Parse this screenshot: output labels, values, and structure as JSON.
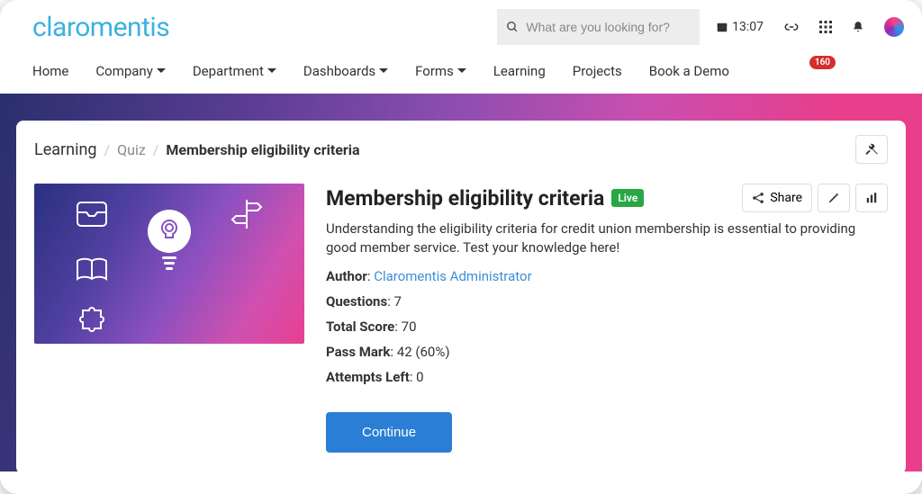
{
  "header": {
    "logo_text": "claromentis",
    "search_placeholder": "What are you looking for?",
    "time": "13:07",
    "notification_count": "160"
  },
  "nav": {
    "items": [
      {
        "label": "Home",
        "dropdown": false
      },
      {
        "label": "Company",
        "dropdown": true
      },
      {
        "label": "Department",
        "dropdown": true
      },
      {
        "label": "Dashboards",
        "dropdown": true
      },
      {
        "label": "Forms",
        "dropdown": true
      },
      {
        "label": "Learning",
        "dropdown": false
      },
      {
        "label": "Projects",
        "dropdown": false
      },
      {
        "label": "Book a Demo",
        "dropdown": false
      }
    ]
  },
  "breadcrumb": {
    "root": "Learning",
    "mid": "Quiz",
    "current": "Membership eligibility criteria"
  },
  "quiz": {
    "title": "Membership eligibility criteria",
    "status_badge": "Live",
    "share_label": "Share",
    "description": "Understanding the eligibility criteria for credit union membership is essential to providing good member service. Test your knowledge here!",
    "author_label": "Author",
    "author_name": "Claromentis Administrator",
    "questions_label": "Questions",
    "questions_value": "7",
    "total_score_label": "Total Score",
    "total_score_value": "70",
    "pass_mark_label": "Pass Mark",
    "pass_mark_value": "42 (60%)",
    "attempts_label": "Attempts Left",
    "attempts_value": "0",
    "continue_label": "Continue"
  }
}
